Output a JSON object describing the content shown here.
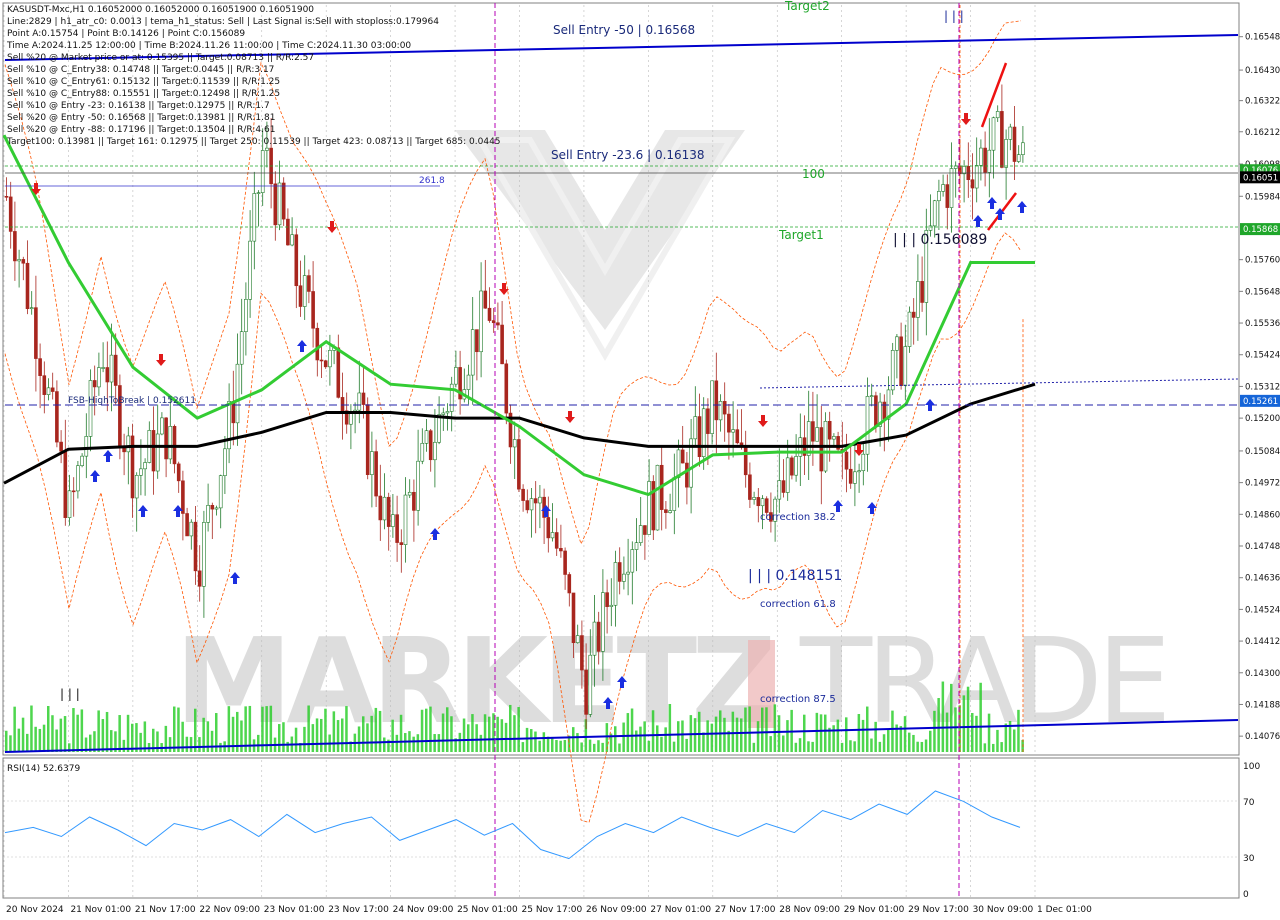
{
  "header": {
    "lines": [
      "KASUSDT-Mxc,H1  0.16052000 0.16052000 0.16051900 0.16051900",
      "Line:2829 | h1_atr_c0: 0.0013 | tema_h1_status: Sell | Last Signal is:Sell with stoploss:0.179964",
      "Point A:0.15754 | Point B:0.14126 | Point C:0.156089",
      "Time A:2024.11.25 12:00:00 | Time B:2024.11.26 11:00:00 | Time C:2024.11.30 03:00:00",
      "Sell %20 @ Market price or at: 0.15395 || Target:0.08713 || R/R:2.57",
      "Sell %10 @ C_Entry38: 0.14748 || Target:0.0445 || R/R:3.17",
      "Sell %10 @ C_Entry61: 0.15132 || Target:0.11539 || R/R:1.25",
      "Sell %10 @ C_Entry88: 0.15551 || Target:0.12498 || R/R:1.25",
      "Sell %10 @ Entry -23: 0.16138 || Target:0.12975 || R/R:1.7",
      "Sell %20 @ Entry -50: 0.16568 || Target:0.13981 || R/R:1.81",
      "Sell %20 @ Entry -88: 0.17196 || Target:0.13504 || R/R:4.61",
      "Target100: 0.13981 || Target 161: 0.12975 || Target 250: 0.11539 || Target 423: 0.08713 || Target 685: 0.0445"
    ]
  },
  "colors": {
    "bull": "#1f7a2a",
    "bear": "#a8261e",
    "ma_fast": "#33cc33",
    "ma_slow": "#000000",
    "trend": "#0000cc",
    "channel": "#ff5500",
    "rsi": "#3399ff",
    "volume": "#22cc22",
    "marker": "#b400b4",
    "watermark": "#d7d7d7",
    "watermark_accent": "#e8a0a0"
  },
  "watermark": {
    "left": "MARKETZ",
    "right": "TRADE"
  },
  "annotations": {
    "sell_entry_50": "Sell Entry -50 | 0.16568",
    "sell_entry_236": "Sell Entry -23.6 | 0.16138",
    "target2": "Target2",
    "target1": "Target1",
    "level_100": "100",
    "level_2618": "261.8",
    "fsb": "FSB-HighToBreak | 0.152611",
    "point_c": "| | | 0.156089",
    "point_b": "| | | 0.148151",
    "corr_382": "correction 38.2",
    "corr_618": "correction 61.8",
    "corr_875": "correction 87.5",
    "bars_left": "| | |",
    "bars_top": "| | |"
  },
  "rsi": {
    "label": "RSI(14) 52.6379",
    "levels": [
      "100",
      "70",
      "30",
      "0"
    ]
  },
  "chart_data": {
    "type": "line",
    "title": "KASUSDT-Mxc,H1",
    "x_labels": [
      "20 Nov 2024",
      "21 Nov 01:00",
      "21 Nov 17:00",
      "22 Nov 09:00",
      "23 Nov 01:00",
      "23 Nov 17:00",
      "24 Nov 09:00",
      "25 Nov 01:00",
      "25 Nov 17:00",
      "26 Nov 09:00",
      "27 Nov 01:00",
      "27 Nov 17:00",
      "28 Nov 09:00",
      "29 Nov 01:00",
      "29 Nov 17:00",
      "30 Nov 09:00",
      "1 Dec 01:00"
    ],
    "y_ticks": [
      "0.16548",
      "0.16430",
      "0.16322",
      "0.16212",
      "0.16098",
      "0.15984",
      "0.15760",
      "0.15648",
      "0.15536",
      "0.15424",
      "0.15312",
      "0.15200",
      "0.15084",
      "0.14972",
      "0.14860",
      "0.14748",
      "0.14636",
      "0.14524",
      "0.14412",
      "0.14300",
      "0.14188",
      "0.14076"
    ],
    "ylim": [
      0.1402,
      0.1666
    ],
    "price_tags": [
      {
        "value": "0.16076",
        "color": "#1fa62a"
      },
      {
        "value": "0.16051",
        "color": "#000000"
      },
      {
        "value": "0.15868",
        "color": "#1fa62a"
      },
      {
        "value": "0.15261",
        "color": "#1565d8"
      }
    ],
    "close_series": [
      {
        "x": "20 Nov 2024",
        "y": 0.16
      },
      {
        "x": "20 Nov 12:00",
        "y": 0.1548
      },
      {
        "x": "21 Nov 01:00",
        "y": 0.1485
      },
      {
        "x": "21 Nov 09:00",
        "y": 0.1545
      },
      {
        "x": "21 Nov 17:00",
        "y": 0.15
      },
      {
        "x": "22 Nov 01:00",
        "y": 0.1515
      },
      {
        "x": "22 Nov 09:00",
        "y": 0.147
      },
      {
        "x": "22 Nov 17:00",
        "y": 0.152
      },
      {
        "x": "23 Nov 01:00",
        "y": 0.1615
      },
      {
        "x": "23 Nov 09:00",
        "y": 0.157
      },
      {
        "x": "23 Nov 17:00",
        "y": 0.154
      },
      {
        "x": "24 Nov 01:00",
        "y": 0.152
      },
      {
        "x": "24 Nov 09:00",
        "y": 0.1475
      },
      {
        "x": "24 Nov 17:00",
        "y": 0.1505
      },
      {
        "x": "25 Nov 01:00",
        "y": 0.1535
      },
      {
        "x": "25 Nov 09:00",
        "y": 0.156
      },
      {
        "x": "25 Nov 17:00",
        "y": 0.15
      },
      {
        "x": "26 Nov 01:00",
        "y": 0.148
      },
      {
        "x": "26 Nov 09:00",
        "y": 0.1425
      },
      {
        "x": "26 Nov 17:00",
        "y": 0.147
      },
      {
        "x": "27 Nov 01:00",
        "y": 0.149
      },
      {
        "x": "27 Nov 09:00",
        "y": 0.15
      },
      {
        "x": "27 Nov 17:00",
        "y": 0.1525
      },
      {
        "x": "28 Nov 01:00",
        "y": 0.15
      },
      {
        "x": "28 Nov 09:00",
        "y": 0.149
      },
      {
        "x": "28 Nov 17:00",
        "y": 0.1515
      },
      {
        "x": "29 Nov 01:00",
        "y": 0.15
      },
      {
        "x": "29 Nov 09:00",
        "y": 0.1525
      },
      {
        "x": "29 Nov 17:00",
        "y": 0.1545
      },
      {
        "x": "30 Nov 01:00",
        "y": 0.16
      },
      {
        "x": "30 Nov 09:00",
        "y": 0.161
      },
      {
        "x": "30 Nov 17:00",
        "y": 0.162
      },
      {
        "x": "1 Dec 01:00",
        "y": 0.16052
      }
    ],
    "ma_fast": [
      {
        "x": "20 Nov 2024",
        "y": 0.162
      },
      {
        "x": "21 Nov 01:00",
        "y": 0.1575
      },
      {
        "x": "21 Nov 17:00",
        "y": 0.1538
      },
      {
        "x": "22 Nov 09:00",
        "y": 0.152
      },
      {
        "x": "23 Nov 01:00",
        "y": 0.153
      },
      {
        "x": "23 Nov 17:00",
        "y": 0.1547
      },
      {
        "x": "24 Nov 09:00",
        "y": 0.1532
      },
      {
        "x": "25 Nov 01:00",
        "y": 0.153
      },
      {
        "x": "25 Nov 17:00",
        "y": 0.1517
      },
      {
        "x": "26 Nov 09:00",
        "y": 0.15
      },
      {
        "x": "27 Nov 01:00",
        "y": 0.1493
      },
      {
        "x": "27 Nov 17:00",
        "y": 0.1507
      },
      {
        "x": "28 Nov 09:00",
        "y": 0.1508
      },
      {
        "x": "29 Nov 01:00",
        "y": 0.1508
      },
      {
        "x": "29 Nov 17:00",
        "y": 0.1525
      },
      {
        "x": "30 Nov 09:00",
        "y": 0.1575
      },
      {
        "x": "1 Dec 01:00",
        "y": 0.1575
      }
    ],
    "ma_slow": [
      {
        "x": "20 Nov 2024",
        "y": 0.1497
      },
      {
        "x": "21 Nov 01:00",
        "y": 0.1509
      },
      {
        "x": "21 Nov 17:00",
        "y": 0.151
      },
      {
        "x": "22 Nov 09:00",
        "y": 0.151
      },
      {
        "x": "23 Nov 01:00",
        "y": 0.1515
      },
      {
        "x": "23 Nov 17:00",
        "y": 0.1522
      },
      {
        "x": "24 Nov 09:00",
        "y": 0.1522
      },
      {
        "x": "25 Nov 01:00",
        "y": 0.152
      },
      {
        "x": "25 Nov 17:00",
        "y": 0.152
      },
      {
        "x": "26 Nov 09:00",
        "y": 0.1513
      },
      {
        "x": "27 Nov 01:00",
        "y": 0.151
      },
      {
        "x": "27 Nov 17:00",
        "y": 0.151
      },
      {
        "x": "28 Nov 09:00",
        "y": 0.151
      },
      {
        "x": "29 Nov 01:00",
        "y": 0.151
      },
      {
        "x": "29 Nov 17:00",
        "y": 0.1514
      },
      {
        "x": "30 Nov 09:00",
        "y": 0.1525
      },
      {
        "x": "1 Dec 01:00",
        "y": 0.1532
      }
    ],
    "rsi_series": [
      48,
      52,
      45,
      60,
      50,
      38,
      55,
      50,
      58,
      45,
      62,
      48,
      55,
      60,
      42,
      50,
      58,
      46,
      55,
      35,
      28,
      45,
      55,
      48,
      60,
      52,
      45,
      55,
      48,
      65,
      58,
      70,
      62,
      80,
      72,
      60,
      52
    ],
    "rsi_ylim": [
      0,
      100
    ]
  }
}
